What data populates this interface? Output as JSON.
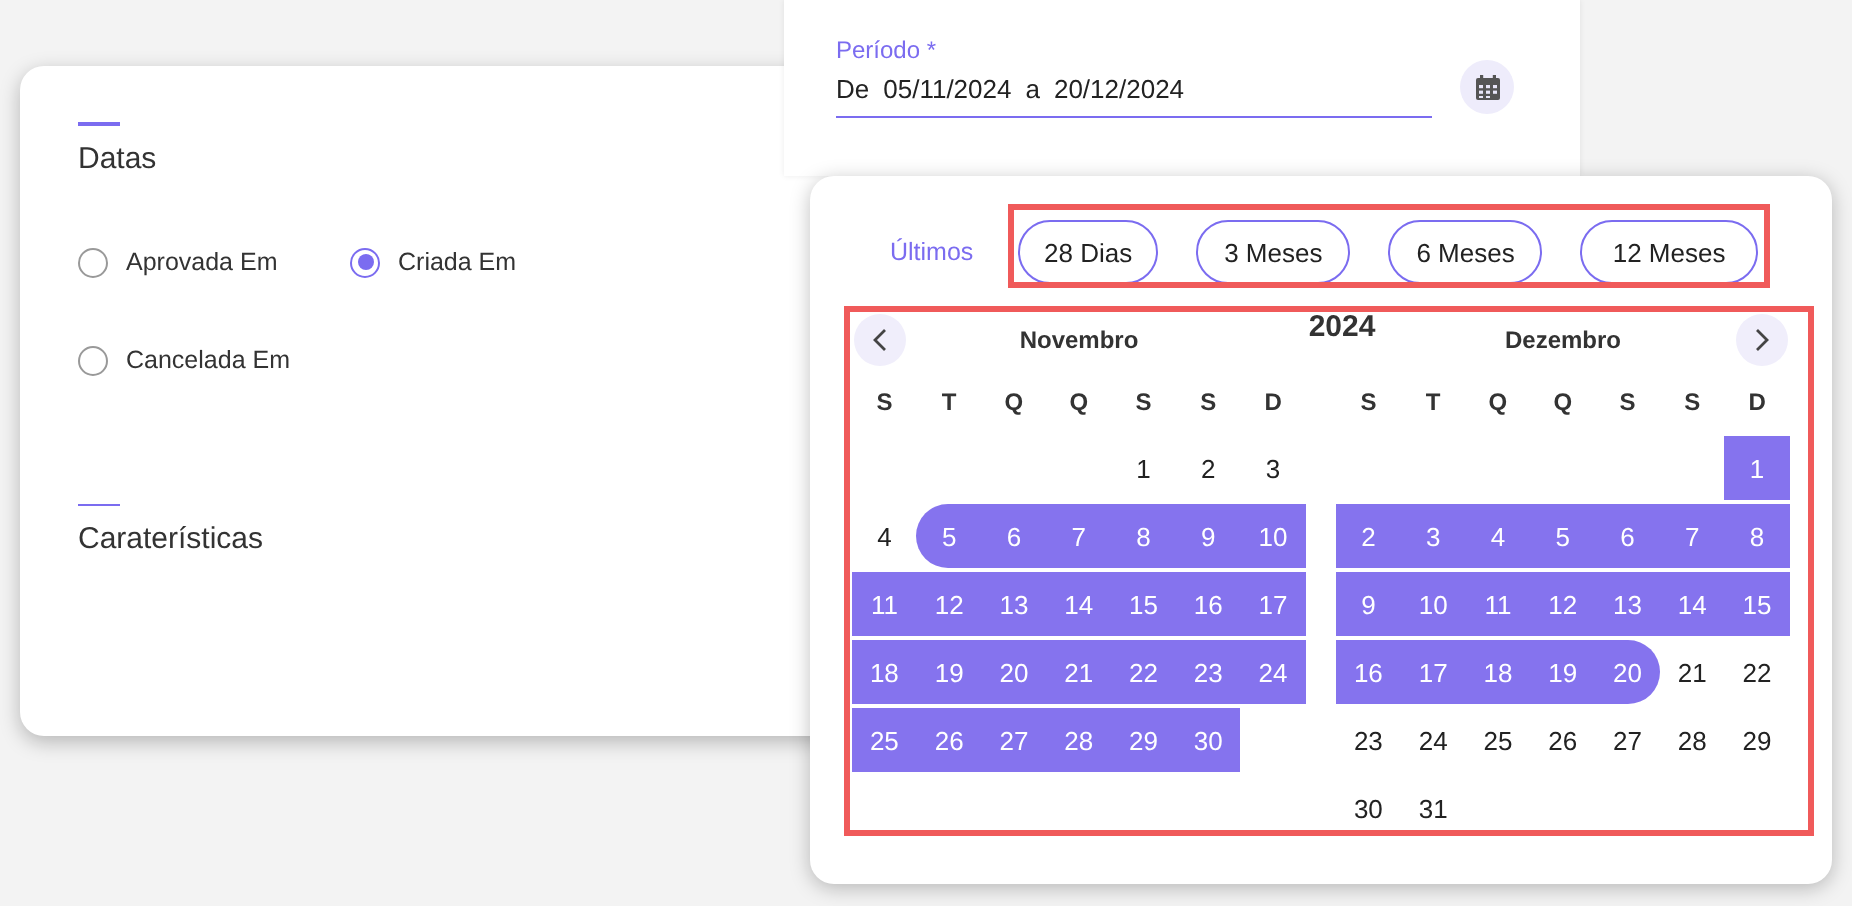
{
  "period_field": {
    "label": "Período *",
    "from_prefix": "De",
    "from": "05/11/2024",
    "separator": "a",
    "to": "20/12/2024"
  },
  "filters_card": {
    "sections": [
      {
        "title": "Datas",
        "options": [
          {
            "label": "Aprovada Em",
            "selected": false
          },
          {
            "label": "Criada Em",
            "selected": true
          },
          {
            "label": "Cancelada Em",
            "selected": false
          }
        ]
      },
      {
        "title": "Caraterísticas"
      }
    ]
  },
  "date_picker": {
    "quick_label": "Últimos",
    "quick_ranges": [
      "28 Dias",
      "3 Meses",
      "6 Meses",
      "12 Meses"
    ],
    "year": "2024",
    "months": [
      {
        "name": "Novembro",
        "weekdays": [
          "S",
          "T",
          "Q",
          "Q",
          "S",
          "S",
          "D"
        ],
        "weeks": [
          [
            {
              "kind": "blank"
            },
            {
              "kind": "blank"
            },
            {
              "kind": "blank"
            },
            {
              "kind": "blank"
            },
            {
              "kind": "day",
              "label": "1",
              "in_range": false
            },
            {
              "kind": "day",
              "label": "2",
              "in_range": false
            },
            {
              "kind": "day",
              "label": "3",
              "in_range": false
            }
          ],
          [
            {
              "kind": "day",
              "label": "4",
              "in_range": false
            },
            {
              "kind": "range_start",
              "label": "5",
              "in_range": true
            },
            {
              "kind": "day",
              "label": "6",
              "in_range": true
            },
            {
              "kind": "day",
              "label": "7",
              "in_range": true
            },
            {
              "kind": "day",
              "label": "8",
              "in_range": true
            },
            {
              "kind": "day",
              "label": "9",
              "in_range": true
            },
            {
              "kind": "day",
              "label": "10",
              "in_range": true
            }
          ],
          [
            {
              "kind": "day",
              "label": "11",
              "in_range": true
            },
            {
              "kind": "day",
              "label": "12",
              "in_range": true
            },
            {
              "kind": "day",
              "label": "13",
              "in_range": true
            },
            {
              "kind": "day",
              "label": "14",
              "in_range": true
            },
            {
              "kind": "day",
              "label": "15",
              "in_range": true
            },
            {
              "kind": "day",
              "label": "16",
              "in_range": true
            },
            {
              "kind": "day",
              "label": "17",
              "in_range": true
            }
          ],
          [
            {
              "kind": "day",
              "label": "18",
              "in_range": true
            },
            {
              "kind": "day",
              "label": "19",
              "in_range": true
            },
            {
              "kind": "day",
              "label": "20",
              "in_range": true
            },
            {
              "kind": "day",
              "label": "21",
              "in_range": true
            },
            {
              "kind": "day",
              "label": "22",
              "in_range": true
            },
            {
              "kind": "day",
              "label": "23",
              "in_range": true
            },
            {
              "kind": "day",
              "label": "24",
              "in_range": true
            }
          ],
          [
            {
              "kind": "day",
              "label": "25",
              "in_range": true
            },
            {
              "kind": "day",
              "label": "26",
              "in_range": true
            },
            {
              "kind": "day",
              "label": "27",
              "in_range": true
            },
            {
              "kind": "day",
              "label": "28",
              "in_range": true
            },
            {
              "kind": "day",
              "label": "29",
              "in_range": true
            },
            {
              "kind": "day",
              "label": "30",
              "in_range": true
            }
          ]
        ]
      },
      {
        "name": "Dezembro",
        "weekdays": [
          "S",
          "T",
          "Q",
          "Q",
          "S",
          "S",
          "D"
        ],
        "weeks": [
          [
            {
              "kind": "blank"
            },
            {
              "kind": "blank"
            },
            {
              "kind": "blank"
            },
            {
              "kind": "blank"
            },
            {
              "kind": "blank"
            },
            {
              "kind": "blank"
            },
            {
              "kind": "day",
              "label": "1",
              "in_range": true
            }
          ],
          [
            {
              "kind": "day",
              "label": "2",
              "in_range": true
            },
            {
              "kind": "day",
              "label": "3",
              "in_range": true
            },
            {
              "kind": "day",
              "label": "4",
              "in_range": true
            },
            {
              "kind": "day",
              "label": "5",
              "in_range": true
            },
            {
              "kind": "day",
              "label": "6",
              "in_range": true
            },
            {
              "kind": "day",
              "label": "7",
              "in_range": true
            },
            {
              "kind": "day",
              "label": "8",
              "in_range": true
            }
          ],
          [
            {
              "kind": "day",
              "label": "9",
              "in_range": true
            },
            {
              "kind": "day",
              "label": "10",
              "in_range": true
            },
            {
              "kind": "day",
              "label": "11",
              "in_range": true
            },
            {
              "kind": "day",
              "label": "12",
              "in_range": true
            },
            {
              "kind": "day",
              "label": "13",
              "in_range": true
            },
            {
              "kind": "day",
              "label": "14",
              "in_range": true
            },
            {
              "kind": "day",
              "label": "15",
              "in_range": true
            }
          ],
          [
            {
              "kind": "day",
              "label": "16",
              "in_range": true
            },
            {
              "kind": "day",
              "label": "17",
              "in_range": true
            },
            {
              "kind": "day",
              "label": "18",
              "in_range": true
            },
            {
              "kind": "day",
              "label": "19",
              "in_range": true
            },
            {
              "kind": "range_end",
              "label": "20",
              "in_range": true
            },
            {
              "kind": "day",
              "label": "21",
              "in_range": false
            },
            {
              "kind": "day",
              "label": "22",
              "in_range": false
            }
          ],
          [
            {
              "kind": "day",
              "label": "23",
              "in_range": false
            },
            {
              "kind": "day",
              "label": "24",
              "in_range": false
            },
            {
              "kind": "day",
              "label": "25",
              "in_range": false
            },
            {
              "kind": "day",
              "label": "26",
              "in_range": false
            },
            {
              "kind": "day",
              "label": "27",
              "in_range": false
            },
            {
              "kind": "day",
              "label": "28",
              "in_range": false
            },
            {
              "kind": "day",
              "label": "29",
              "in_range": false
            }
          ],
          [
            {
              "kind": "day",
              "label": "30",
              "in_range": false
            },
            {
              "kind": "day",
              "label": "31",
              "in_range": false
            }
          ]
        ]
      }
    ]
  }
}
